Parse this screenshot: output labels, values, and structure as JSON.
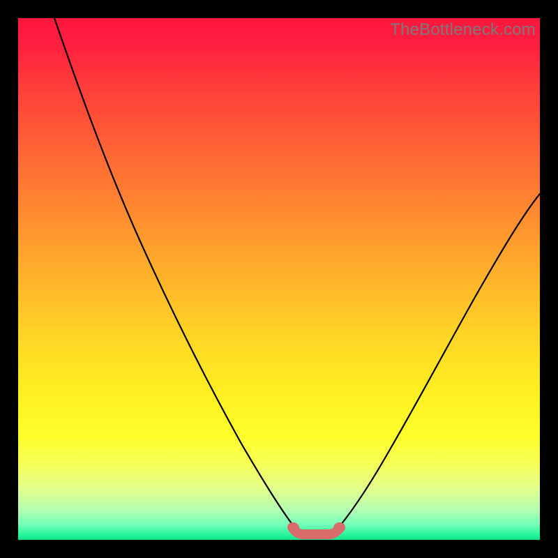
{
  "watermark": "TheBottleneck.com",
  "colors": {
    "frame": "#000000",
    "curve": "#000000",
    "accent": "#d96b6b",
    "grad_top": "#ff163e",
    "grad_bottom": "#12e38d"
  },
  "chart_data": {
    "type": "line",
    "title": "",
    "xlabel": "",
    "ylabel": "",
    "xlim": [
      0,
      100
    ],
    "ylim": [
      0,
      100
    ],
    "series": [
      {
        "name": "left-branch",
        "x": [
          7,
          10,
          15,
          20,
          25,
          30,
          35,
          40,
          45,
          50,
          53
        ],
        "y": [
          100,
          93,
          82,
          71,
          60,
          49,
          38,
          27,
          16,
          6,
          2
        ]
      },
      {
        "name": "right-branch",
        "x": [
          61,
          64,
          68,
          72,
          76,
          80,
          84,
          88,
          92,
          96,
          100
        ],
        "y": [
          2,
          6,
          12,
          18,
          25,
          32,
          39,
          46,
          53,
          60,
          66
        ]
      },
      {
        "name": "flat-bottom-accent",
        "x": [
          53,
          54,
          56,
          58,
          60,
          61
        ],
        "y": [
          2,
          1,
          1,
          1,
          1,
          2
        ]
      }
    ],
    "annotations": []
  }
}
